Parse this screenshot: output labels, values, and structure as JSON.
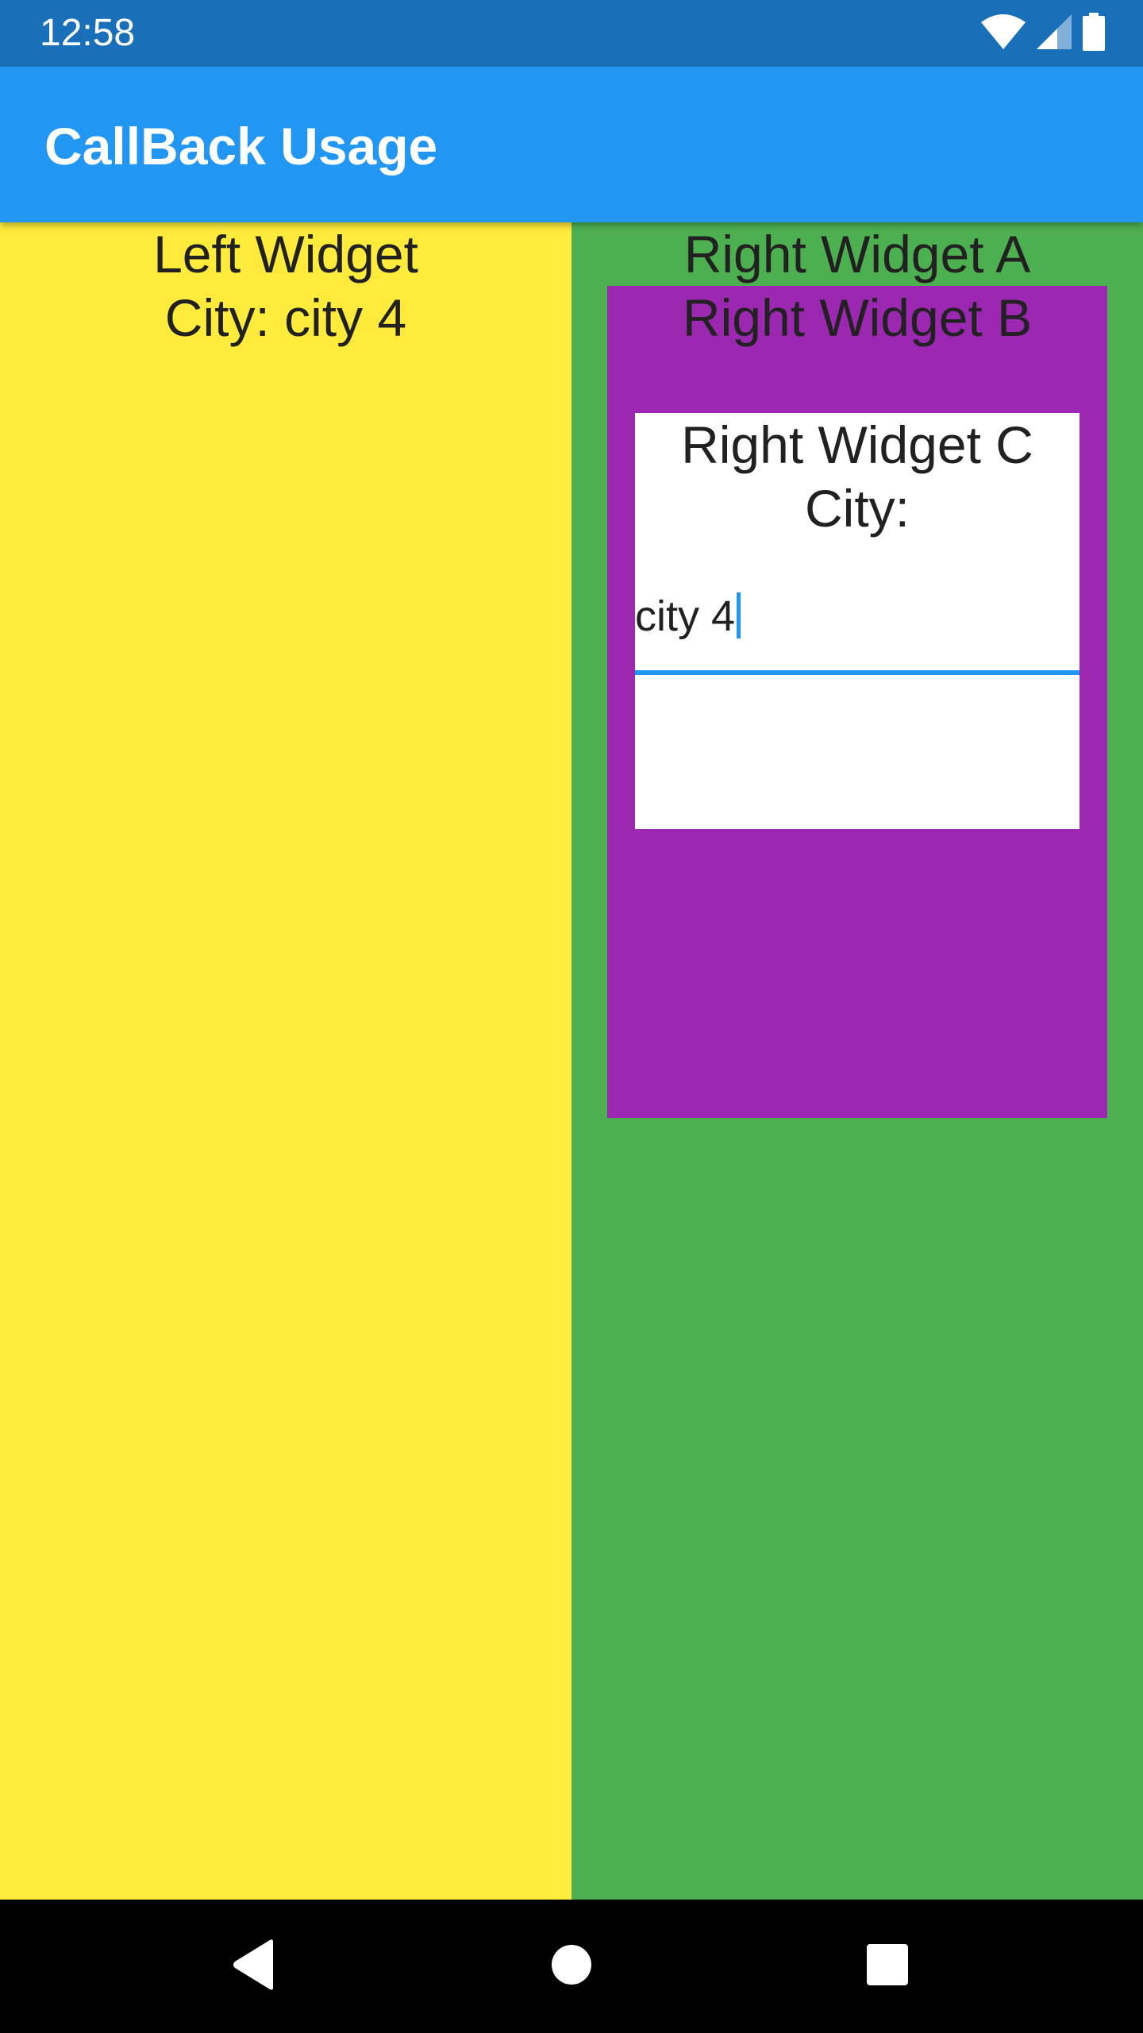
{
  "status_bar": {
    "time": "12:58",
    "icons": [
      "wifi-icon",
      "cell-signal-icon",
      "battery-icon"
    ]
  },
  "app_bar": {
    "title": "CallBack Usage"
  },
  "left_widget": {
    "label": "Left Widget",
    "city_text": "City: city 4",
    "background": "#FFEB3B"
  },
  "right_widget_a": {
    "label": "Right Widget A",
    "background": "#4CAF50"
  },
  "right_widget_b": {
    "label": "Right Widget B",
    "background": "#9C27B0"
  },
  "right_widget_c": {
    "label": "Right Widget C",
    "city_label": "City:",
    "background": "#FFFFFF",
    "city_input": {
      "value": "city 4"
    }
  },
  "colors": {
    "status_bar": "#1A70B8",
    "app_bar": "#2196F3",
    "accent": "#2196F3",
    "nav_bar": "#000000"
  },
  "nav_bar": {
    "buttons": [
      "back-icon",
      "home-icon",
      "recents-icon"
    ]
  }
}
